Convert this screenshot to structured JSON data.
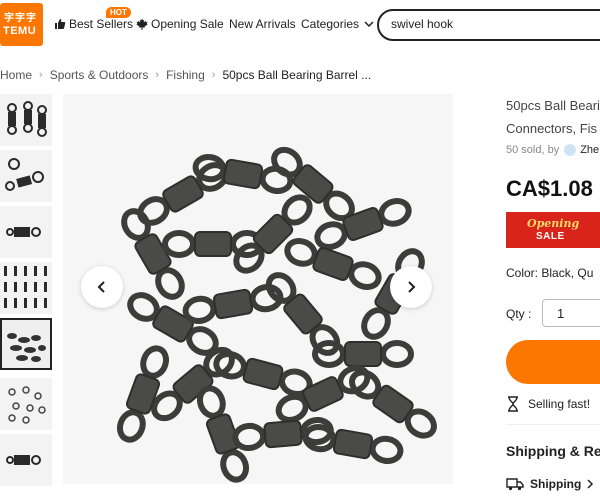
{
  "header": {
    "logo_top": "字字字",
    "logo_name": "TEMU",
    "nav": {
      "best_sellers": "Best Sellers",
      "hot_badge": "HOT",
      "opening_sale": "Opening Sale",
      "new_arrivals": "New Arrivals",
      "categories": "Categories"
    },
    "search": {
      "value": "swivel hook"
    }
  },
  "breadcrumb": {
    "home": "Home",
    "sports": "Sports & Outdoors",
    "fishing": "Fishing",
    "current": "50pcs Ball Bearing Barrel ..."
  },
  "product": {
    "title_line1": "50pcs Ball Beari",
    "title_line2": "Connectors, Fis",
    "sold_text": "50 sold, by",
    "seller": "Zhe",
    "price_currency": "CA$",
    "price_value": "1.08",
    "sale_banner_line1": "Opening",
    "sale_banner_line2": "SALE",
    "color_label": "Color:",
    "color_value": "Black, Qu",
    "qty_label": "Qty :",
    "qty_value": "1",
    "selling_fast": "Selling fast!",
    "shipping_heading": "Shipping & Re",
    "shipping_label": "Shipping"
  },
  "gallery": {
    "thumb_count": 7,
    "selected_index": 4
  },
  "colors": {
    "brand": "#fb7701",
    "sale_red": "#d8241b"
  },
  "icons": [
    "thumbs-up-icon",
    "maple-leaf-icon",
    "chevron-down-icon",
    "chevron-left-icon",
    "chevron-right-icon",
    "hourglass-icon",
    "truck-icon",
    "seller-icon"
  ]
}
